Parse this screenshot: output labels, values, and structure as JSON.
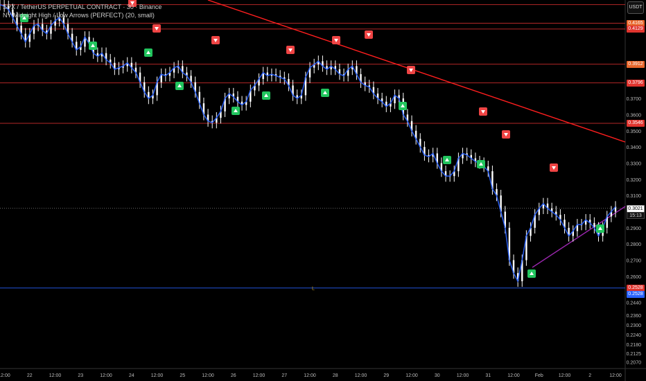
{
  "legend": {
    "symbol_line": "SPX / TetherUS PERPETUAL CONTRACT · 30 · Binance",
    "indicator_line": "NY Midnight High / Low Arrows (PERFECT) (20, small)"
  },
  "currency": "USDT",
  "colors": {
    "background": "#000000",
    "candle": "#ffffff",
    "line": "#2962ff",
    "horizontal_red": "#d32f2f",
    "support_blue": "#2962ff",
    "trend_red": "#ff1e1e",
    "trend_purple": "#9c27b0",
    "up_arrow": "#22c55e",
    "down_arrow": "#ef4444"
  },
  "price_axis": {
    "ticks": [
      "0.3700",
      "0.3600",
      "0.3500",
      "0.3400",
      "0.3300",
      "0.3200",
      "0.3100",
      "0.2900",
      "0.2800",
      "0.2700",
      "0.2600",
      "0.2440",
      "0.2360",
      "0.2300",
      "0.2240",
      "0.2180",
      "0.2125",
      "0.2070"
    ],
    "ymin": 0.203,
    "ymax": 0.43
  },
  "level_tags": [
    {
      "label": "0.4165",
      "price": 0.4165,
      "style": "orange"
    },
    {
      "label": "0.4129",
      "price": 0.4129,
      "style": "red"
    },
    {
      "label": "0.3912",
      "price": 0.3912,
      "style": "orange"
    },
    {
      "label": "0.3796",
      "price": 0.3796,
      "style": "red"
    },
    {
      "label": "0.3546",
      "price": 0.3546,
      "style": "red"
    },
    {
      "label": "0.2528",
      "price": 0.2528,
      "style": "red"
    },
    {
      "label": "0.2528",
      "price": 0.2528,
      "style": "blue"
    }
  ],
  "current_price": {
    "label": "0.3021",
    "price": 0.3021,
    "countdown": "15:13"
  },
  "time_axis": {
    "labels": [
      "12:00",
      "22",
      "12:00",
      "23",
      "12:00",
      "24",
      "12:00",
      "25",
      "12:00",
      "26",
      "12:00",
      "27",
      "12:00",
      "28",
      "12:00",
      "29",
      "12:00",
      "30",
      "12:00",
      "31",
      "12:00",
      "Feb",
      "12:00",
      "2",
      "12:00"
    ]
  },
  "chart_data": {
    "type": "line",
    "series": [
      {
        "values": [
          0.428,
          0.427,
          0.425,
          0.42,
          0.415,
          0.41,
          0.405,
          0.41,
          0.415,
          0.416,
          0.412,
          0.41,
          0.415,
          0.418,
          0.42,
          0.416,
          0.41,
          0.405,
          0.4,
          0.402,
          0.408,
          0.404,
          0.398,
          0.396,
          0.398,
          0.394,
          0.392,
          0.388,
          0.389,
          0.39,
          0.392,
          0.389,
          0.386,
          0.38,
          0.374,
          0.37,
          0.372,
          0.38,
          0.385,
          0.384,
          0.386,
          0.389,
          0.39,
          0.386,
          0.384,
          0.38,
          0.374,
          0.367,
          0.36,
          0.356,
          0.355,
          0.358,
          0.362,
          0.37,
          0.373,
          0.371,
          0.368,
          0.366,
          0.368,
          0.375,
          0.378,
          0.382,
          0.386,
          0.384,
          0.385,
          0.384,
          0.383,
          0.382,
          0.378,
          0.372,
          0.37,
          0.372,
          0.383,
          0.389,
          0.391,
          0.393,
          0.39,
          0.388,
          0.39,
          0.388,
          0.385,
          0.384,
          0.388,
          0.39,
          0.385,
          0.38,
          0.378,
          0.377,
          0.373,
          0.37,
          0.368,
          0.365,
          0.367,
          0.372,
          0.37,
          0.36,
          0.356,
          0.35,
          0.345,
          0.34,
          0.335,
          0.334,
          0.336,
          0.33,
          0.325,
          0.322,
          0.322,
          0.325,
          0.333,
          0.336,
          0.335,
          0.333,
          0.331,
          0.33,
          0.328,
          0.325,
          0.314,
          0.31,
          0.3,
          0.29,
          0.27,
          0.262,
          0.257,
          0.27,
          0.285,
          0.29,
          0.298,
          0.302,
          0.305,
          0.302,
          0.3,
          0.298,
          0.295,
          0.29,
          0.285,
          0.288,
          0.292,
          0.292,
          0.295,
          0.293,
          0.29,
          0.285,
          0.29,
          0.297,
          0.3,
          0.303
        ]
      }
    ],
    "horizontal_levels": [
      0.4165,
      0.4129,
      0.3912,
      0.3796,
      0.3546,
      0.2528
    ],
    "up_arrows": 13,
    "down_arrows": 9,
    "ylim": [
      0.203,
      0.43
    ]
  }
}
